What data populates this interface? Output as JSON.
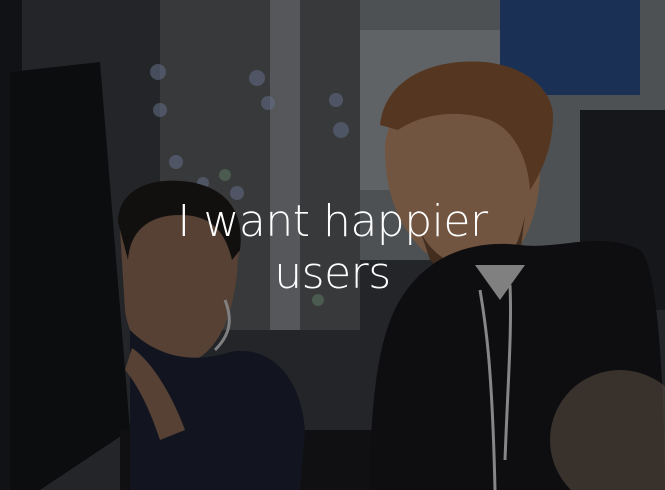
{
  "tile": {
    "headline_line1": "I want happier",
    "headline_line2": "users"
  },
  "colors": {
    "overlay": "#000000",
    "text": "#ffffff",
    "accent_blue": "#1f4a8c"
  }
}
